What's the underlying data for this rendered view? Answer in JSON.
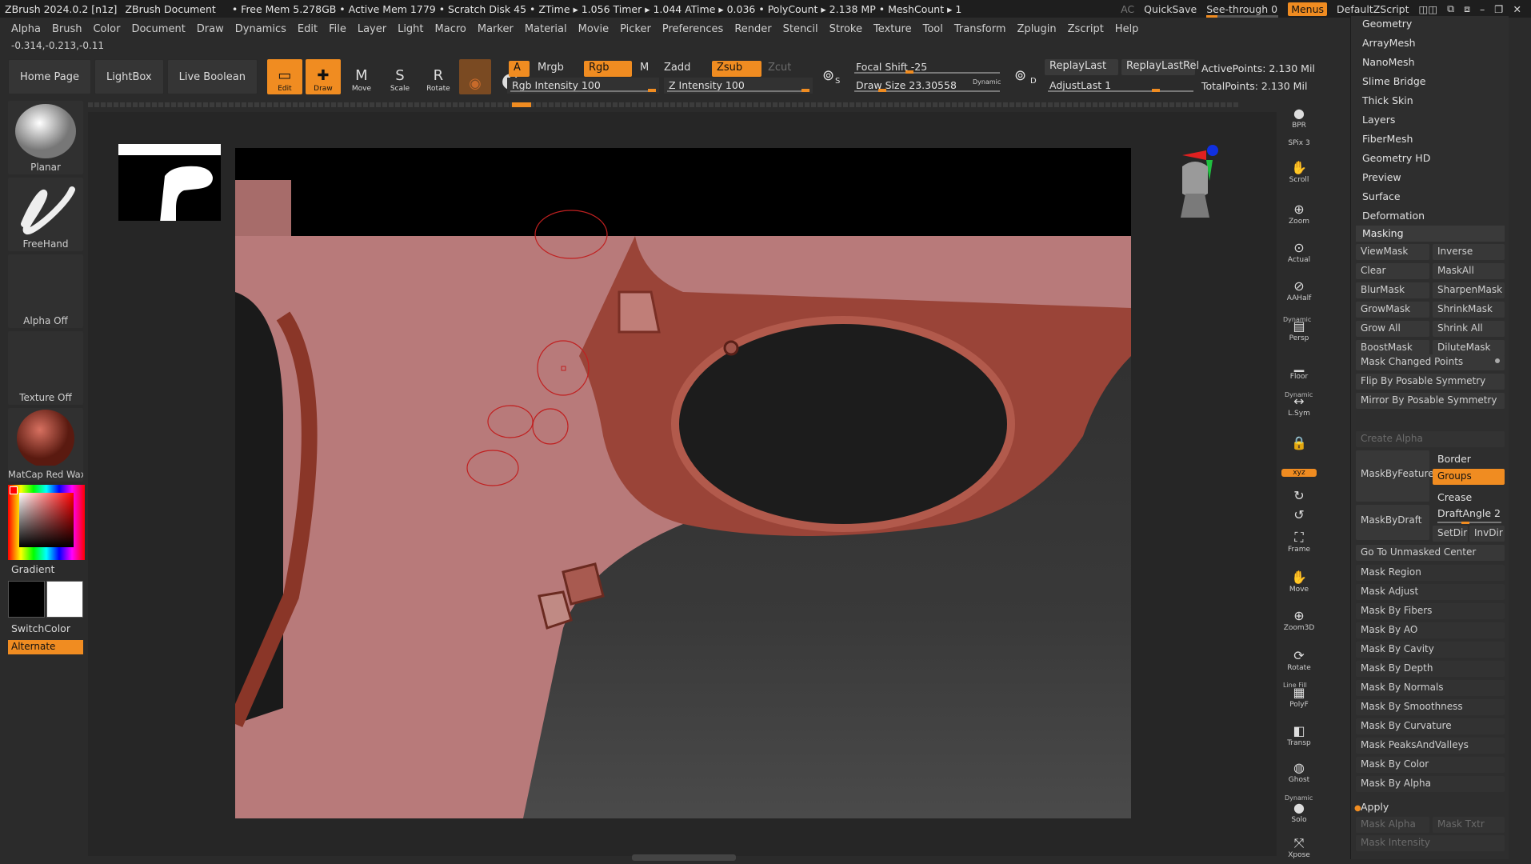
{
  "titlebar": {
    "app": "ZBrush 2024.0.2 [n1z]",
    "document": "ZBrush Document",
    "stats": "• Free Mem 5.278GB • Active Mem 1779 • Scratch Disk 45 • ZTime ▸ 1.056 Timer ▸ 1.044 ATime ▸ 0.036 • PolyCount ▸ 2.138 MP • MeshCount ▸ 1",
    "ac": "AC",
    "quicksave": "QuickSave",
    "seethrough": "See-through 0",
    "menus": "Menus",
    "script": "DefaultZScript"
  },
  "menubar": [
    "Alpha",
    "Brush",
    "Color",
    "Document",
    "Draw",
    "Dynamics",
    "Edit",
    "File",
    "Layer",
    "Light",
    "Macro",
    "Marker",
    "Material",
    "Movie",
    "Picker",
    "Preferences",
    "Render",
    "Stencil",
    "Stroke",
    "Texture",
    "Tool",
    "Transform",
    "Zplugin",
    "Zscript",
    "Help"
  ],
  "coords": "-0.314,-0.213,-0.11",
  "shelf": {
    "home": "Home Page",
    "lightbox": "LightBox",
    "liveboolean": "Live Boolean",
    "tools": [
      {
        "label": "Edit",
        "icon": "▭"
      },
      {
        "label": "Draw",
        "icon": "✚"
      },
      {
        "label": "Move",
        "icon": "M"
      },
      {
        "label": "Scale",
        "icon": "S"
      },
      {
        "label": "Rotate",
        "icon": "R"
      }
    ]
  },
  "params": {
    "a": "A",
    "mrgb": "Mrgb",
    "rgb": "Rgb",
    "m": "M",
    "zadd": "Zadd",
    "zsub": "Zsub",
    "zcut": "Zcut",
    "rgb_intensity": "Rgb Intensity 100",
    "z_intensity": "Z Intensity 100",
    "focal_shift": "Focal Shift -25",
    "draw_size": "Draw Size 23.30558",
    "dynamic": "Dynamic",
    "replay_last": "ReplayLast",
    "replay_last_rel": "ReplayLastRel",
    "adjust_last": "AdjustLast 1",
    "active_points": "ActivePoints: 2.130 Mil",
    "total_points": "TotalPoints: 2.130 Mil",
    "s_label": "S",
    "d_label": "D"
  },
  "left_tray": {
    "brush": "Planar",
    "stroke": "FreeHand",
    "alpha": "Alpha Off",
    "texture": "Texture Off",
    "material": "MatCap Red Wax",
    "gradient": "Gradient",
    "switchcolor": "SwitchColor",
    "alternate": "Alternate"
  },
  "right_toolbar": [
    {
      "label": "BPR",
      "icon": "●"
    },
    {
      "label": "SPix 3",
      "icon": ""
    },
    {
      "label": "Scroll",
      "icon": "✋"
    },
    {
      "label": "Zoom",
      "icon": "⊕"
    },
    {
      "label": "Actual",
      "icon": "⊙"
    },
    {
      "label": "AAHalf",
      "icon": "⊘"
    },
    {
      "label": "Persp",
      "icon": "▤"
    },
    {
      "label": "Floor",
      "icon": "▁"
    },
    {
      "label": "L.Sym",
      "icon": "↔"
    },
    {
      "label": "",
      "icon": "🔒"
    },
    {
      "label": "xyz",
      "icon": ""
    },
    {
      "label": "",
      "icon": "↻"
    },
    {
      "label": "",
      "icon": "↺"
    },
    {
      "label": "Frame",
      "icon": "⛶"
    },
    {
      "label": "Move",
      "icon": "✋"
    },
    {
      "label": "Zoom3D",
      "icon": "⊕"
    },
    {
      "label": "Rotate",
      "icon": "⟳"
    },
    {
      "label": "PolyF",
      "icon": "▦"
    },
    {
      "label": "Transp",
      "icon": "◧"
    },
    {
      "label": "Ghost",
      "icon": "◍"
    },
    {
      "label": "Solo",
      "icon": "●"
    },
    {
      "label": "Xpose",
      "icon": "⤧"
    }
  ],
  "right_toolbar_small": {
    "dynamic1": "Dynamic",
    "dynamic2": "Dynamic",
    "linefill": "Line Fill",
    "dynamic3": "Dynamic"
  },
  "right_panel": {
    "top_items": [
      "Geometry",
      "ArrayMesh",
      "NanoMesh",
      "Slime Bridge",
      "Thick Skin",
      "Layers",
      "FiberMesh",
      "Geometry HD",
      "Preview",
      "Surface",
      "Deformation"
    ],
    "masking": "Masking",
    "pairs": [
      [
        "ViewMask",
        "Inverse"
      ],
      [
        "Clear",
        "MaskAll"
      ],
      [
        "BlurMask",
        "SharpenMask"
      ],
      [
        "GrowMask",
        "ShrinkMask"
      ],
      [
        "Grow All",
        "Shrink All"
      ],
      [
        "BoostMask",
        "DiluteMask"
      ]
    ],
    "mask_changed": "Mask Changed Points",
    "flip_posable": "Flip By Posable Symmetry",
    "mirror_posable": "Mirror By Posable Symmetry",
    "create_alpha": "Create Alpha",
    "mask_by_feature": "MaskByFeature",
    "border": "Border",
    "groups": "Groups",
    "crease": "Crease",
    "mask_by_draft": "MaskByDraft",
    "draft_angle": "DraftAngle 2",
    "setdir": "SetDir",
    "invdir": "InvDir",
    "go_unmasked": "Go To Unmasked Center",
    "lists": [
      "Mask Region",
      "Mask Adjust",
      "Mask By Fibers",
      "Mask By AO",
      "Mask By Cavity",
      "Mask By Depth",
      "Mask By Normals",
      "Mask By Smoothness",
      "Mask By Curvature",
      "Mask PeaksAndValleys",
      "Mask By Color",
      "Mask By Alpha"
    ],
    "apply": "Apply",
    "mask_alpha": "Mask Alpha",
    "mask_txtr": "Mask Txtr",
    "mask_intensity": "Mask Intensity"
  }
}
